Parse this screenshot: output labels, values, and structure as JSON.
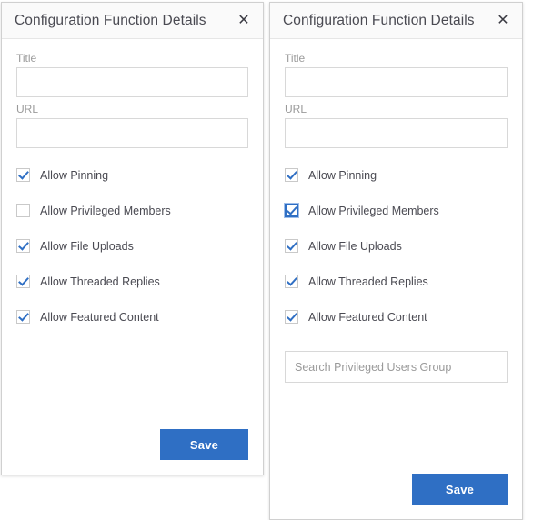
{
  "colors": {
    "accent": "#2f6fc4",
    "panel_border": "#d0d0d0",
    "header_bg": "#fafafa",
    "label_text": "#9a9a9a",
    "body_text": "#4a4a52",
    "page_bg": "#ffffff"
  },
  "panels": [
    {
      "id": "left",
      "header": {
        "title": "Configuration Function Details",
        "close_label": "✕"
      },
      "fields": [
        {
          "label": "Title",
          "value": "",
          "placeholder": ""
        },
        {
          "label": "URL",
          "value": "",
          "placeholder": ""
        }
      ],
      "checkboxes": [
        {
          "label": "Allow Pinning",
          "checked": true,
          "focused": false
        },
        {
          "label": "Allow Privileged Members",
          "checked": false,
          "focused": false
        },
        {
          "label": "Allow File Uploads",
          "checked": true,
          "focused": false
        },
        {
          "label": "Allow Threaded Replies",
          "checked": true,
          "focused": false
        },
        {
          "label": "Allow Featured Content",
          "checked": true,
          "focused": false
        }
      ],
      "search": null,
      "save_label": "Save"
    },
    {
      "id": "right",
      "header": {
        "title": "Configuration Function Details",
        "close_label": "✕"
      },
      "fields": [
        {
          "label": "Title",
          "value": "",
          "placeholder": ""
        },
        {
          "label": "URL",
          "value": "",
          "placeholder": ""
        }
      ],
      "checkboxes": [
        {
          "label": "Allow Pinning",
          "checked": true,
          "focused": false
        },
        {
          "label": "Allow Privileged Members",
          "checked": true,
          "focused": true
        },
        {
          "label": "Allow File Uploads",
          "checked": true,
          "focused": false
        },
        {
          "label": "Allow Threaded Replies",
          "checked": true,
          "focused": false
        },
        {
          "label": "Allow Featured Content",
          "checked": true,
          "focused": false
        }
      ],
      "search": {
        "value": "",
        "placeholder": "Search Privileged Users Group"
      },
      "save_label": "Save"
    }
  ]
}
